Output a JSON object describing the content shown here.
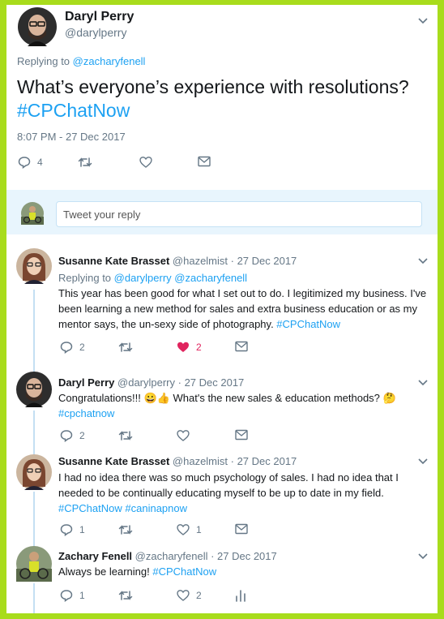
{
  "main_tweet": {
    "name": "Daryl Perry",
    "handle": "@darylperry",
    "replying_prefix": "Replying to ",
    "replying_to": "@zacharyfenell",
    "text": "What’s everyone’s experience with resolutions? ",
    "hashtag": "#CPChatNow",
    "timestamp": "8:07 PM - 27 Dec 2017",
    "reply_count": "4"
  },
  "composer": {
    "placeholder": "Tweet your reply"
  },
  "replies": [
    {
      "name": "Susanne Kate Brasset",
      "handle": "@hazelmist",
      "date": " · 27 Dec 2017",
      "replying_prefix": "Replying to ",
      "replying_to_1": "@darylperry",
      "replying_to_2": "@zacharyfenell",
      "text": "This year has been good for what I set out to do. I legitimized my business. I've been learning a new method for sales and extra business education or as my mentor says, the un-sexy side of photography. ",
      "hashtag": "#CPChatNow",
      "reply_count": "2",
      "like_count": "2"
    },
    {
      "name": "Daryl Perry",
      "handle": "@darylperry",
      "date": " · 27 Dec 2017",
      "text": "Congratulations!!! ",
      "emojis": "😀👍",
      "text_2": " What's the new sales & education methods? ",
      "emoji_end": "🤔",
      "hashtag": "#cpchatnow",
      "reply_count": "2"
    },
    {
      "name": "Susanne Kate Brasset",
      "handle": "@hazelmist",
      "date": " · 27 Dec 2017",
      "text": "I had no idea there was so much psychology of sales. I had no idea that I needed to be continually educating myself to be up to date in my field. ",
      "hashtag_1": "#CPChatNow",
      "hashtag_2": "#caninapnow",
      "reply_count": "1",
      "like_count": "1"
    },
    {
      "name": "Zachary Fenell",
      "handle": "@zacharyfenell",
      "date": " · 27 Dec 2017",
      "text": "Always be learning! ",
      "hashtag": "#CPChatNow",
      "reply_count": "1",
      "like_count": "2"
    }
  ],
  "colors": {
    "accent": "#1da1f2",
    "like_active": "#e0245e",
    "frame": "#a8dc1c"
  }
}
